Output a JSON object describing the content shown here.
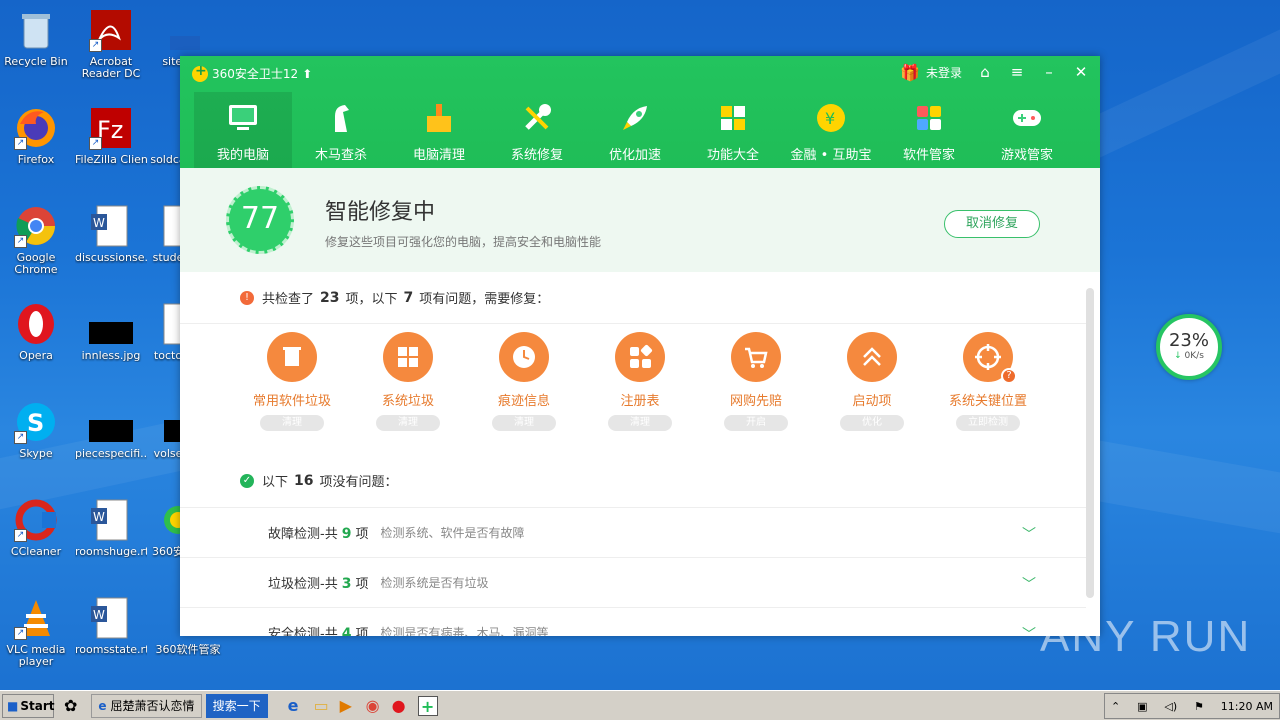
{
  "desktop": {
    "icons": [
      {
        "label": "Recycle Bin"
      },
      {
        "label": "Acrobat Reader DC"
      },
      {
        "label": "sitess"
      },
      {
        "label": "Firefox"
      },
      {
        "label": "FileZilla Client"
      },
      {
        "label": "soldca"
      },
      {
        "label": "Google Chrome"
      },
      {
        "label": "discussionse..."
      },
      {
        "label": "stude"
      },
      {
        "label": "Opera"
      },
      {
        "label": "innless.jpg"
      },
      {
        "label": "tocto"
      },
      {
        "label": "Skype"
      },
      {
        "label": "piecespecifi..."
      },
      {
        "label": "volse"
      },
      {
        "label": "CCleaner"
      },
      {
        "label": "roomshuge.rtf"
      },
      {
        "label": "360安"
      },
      {
        "label": "VLC media player"
      },
      {
        "label": "roomsstate.rtf"
      },
      {
        "label": "360软件管家"
      }
    ]
  },
  "app": {
    "title": "360安全卫士12",
    "login": "未登录",
    "nav": [
      {
        "label": "我的电脑"
      },
      {
        "label": "木马查杀"
      },
      {
        "label": "电脑清理"
      },
      {
        "label": "系统修复"
      },
      {
        "label": "优化加速"
      },
      {
        "label": "功能大全"
      },
      {
        "label": "金融 • 互助宝"
      },
      {
        "label": "软件管家"
      },
      {
        "label": "游戏管家"
      }
    ],
    "status": {
      "score": "77",
      "title": "智能修复中",
      "subtitle": "修复这些项目可强化您的电脑，提高安全和电脑性能",
      "cancel_label": "取消修复"
    },
    "summary": {
      "prefix": "共检查了",
      "total": "23",
      "mid": "项，以下",
      "issues": "7",
      "suffix": "项有问题，需要修复："
    },
    "issues": [
      {
        "name": "常用软件垃圾",
        "action": "清理",
        "icon": "trash-icon"
      },
      {
        "name": "系统垃圾",
        "action": "清理",
        "icon": "windows-icon"
      },
      {
        "name": "痕迹信息",
        "action": "清理",
        "icon": "clock-icon"
      },
      {
        "name": "注册表",
        "action": "清理",
        "icon": "registry-icon"
      },
      {
        "name": "网购先赔",
        "action": "开启",
        "icon": "cart-icon"
      },
      {
        "name": "启动项",
        "action": "优化",
        "icon": "chevrons-up-icon"
      },
      {
        "name": "系统关键位置",
        "action": "立即检测",
        "icon": "target-icon"
      }
    ],
    "ok_summary": {
      "prefix": "以下",
      "count": "16",
      "suffix": "项没有问题："
    },
    "ok_rows": [
      {
        "title": "故障检测-共",
        "count": "9",
        "unit": "项",
        "desc": "检测系统、软件是否有故障"
      },
      {
        "title": "垃圾检测-共",
        "count": "3",
        "unit": "项",
        "desc": "检测系统是否有垃圾"
      },
      {
        "title": "安全检测-共",
        "count": "4",
        "unit": "项",
        "desc": "检测是否有病毒、木马、漏洞等"
      }
    ]
  },
  "meter": {
    "percent": "23%",
    "speed": "0K/s"
  },
  "watermark": "ANY RUN",
  "taskbar": {
    "start_label": "Start",
    "ie_window": "屈楚萧否认恋情",
    "search_label": "搜索一下",
    "time": "11:20 AM"
  }
}
